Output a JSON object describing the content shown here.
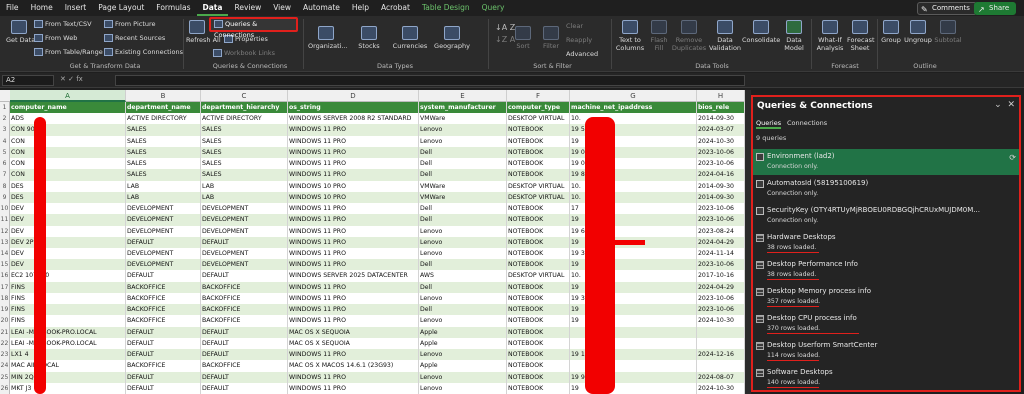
{
  "menu": {
    "tabs": [
      "File",
      "Home",
      "Insert",
      "Page Layout",
      "Formulas",
      "Data",
      "Review",
      "View",
      "Automate",
      "Help",
      "Acrobat",
      "Table Design",
      "Query"
    ],
    "active": "Data",
    "comments_label": "Comments",
    "share_label": "Share"
  },
  "ribbon": {
    "get_data": "Get Data",
    "from_text_csv": "From Text/CSV",
    "from_web": "From Web",
    "from_table_range": "From Table/Range",
    "from_picture": "From Picture",
    "recent_sources": "Recent Sources",
    "existing_connections": "Existing Connections",
    "group_get_transform": "Get & Transform Data",
    "refresh_all": "Refresh All",
    "queries_connections": "Queries & Connections",
    "properties": "Properties",
    "workbook_links": "Workbook Links",
    "group_queries": "Queries & Connections",
    "organization": "Organizati...",
    "stocks": "Stocks",
    "currencies": "Currencies",
    "geography": "Geography",
    "group_data_types": "Data Types",
    "sort": "Sort",
    "filter": "Filter",
    "clear": "Clear",
    "reapply": "Reapply",
    "advanced": "Advanced",
    "group_sort_filter": "Sort & Filter",
    "text_to_columns": "Text to Columns",
    "flash_fill": "Flash Fill",
    "remove_duplicates": "Remove Duplicates",
    "data_validation": "Data Validation",
    "consolidate": "Consolidate",
    "data_model": "Data Model",
    "group_data_tools": "Data Tools",
    "what_if": "What-If Analysis",
    "forecast_sheet": "Forecast Sheet",
    "group_forecast": "Forecast",
    "group_btn": "Group",
    "ungroup_btn": "Ungroup",
    "subtotal": "Subtotal",
    "group_outline": "Outline"
  },
  "formula_bar": {
    "name_box": "A2",
    "fx": "fx",
    "formula": ""
  },
  "sheet": {
    "column_letters": [
      "A",
      "B",
      "C",
      "D",
      "E",
      "F",
      "G",
      "H"
    ],
    "headers": [
      "computer_name",
      "department_name",
      "department_hierarchy",
      "os_string",
      "system_manufacturer",
      "computer_type",
      "machine_net_ipaddress",
      "bios_rele"
    ],
    "rows": [
      [
        "ADS",
        "ACTIVE DIRECTORY",
        "ACTIVE DIRECTORY",
        "WINDOWS SERVER 2008 R2 STANDARD",
        "VMWare",
        "DESKTOP VIRTUAL",
        "10.",
        "2014-09-30"
      ],
      [
        "CON  908",
        "SALES",
        "SALES",
        "WINDOWS 11 PRO",
        "Lenovo",
        "NOTEBOOK",
        "19  55",
        "2024-03-07"
      ],
      [
        "CON",
        "SALES",
        "SALES",
        "WINDOWS 11 PRO",
        "Lenovo",
        "NOTEBOOK",
        "19",
        "2024-10-30"
      ],
      [
        "CON",
        "SALES",
        "SALES",
        "WINDOWS 11 PRO",
        "Dell",
        "NOTEBOOK",
        "19  0",
        "2023-10-06"
      ],
      [
        "CON",
        "SALES",
        "SALES",
        "WINDOWS 11 PRO",
        "Dell",
        "NOTEBOOK",
        "19  0",
        "2023-10-06"
      ],
      [
        "CON",
        "SALES",
        "SALES",
        "WINDOWS 11 PRO",
        "Dell",
        "NOTEBOOK",
        "19  8",
        "2024-04-16"
      ],
      [
        "DES",
        "LAB",
        "LAB",
        "WINDOWS 10 PRO",
        "VMWare",
        "DESKTOP VIRTUAL",
        "10.",
        "2014-09-30"
      ],
      [
        "DES",
        "LAB",
        "LAB",
        "WINDOWS 10 PRO",
        "VMWare",
        "DESKTOP VIRTUAL",
        "10.",
        "2014-09-30"
      ],
      [
        "DEV",
        "DEVELOPMENT",
        "DEVELOPMENT",
        "WINDOWS 11 PRO",
        "Dell",
        "NOTEBOOK",
        "17",
        "2023-10-06"
      ],
      [
        "DEV",
        "DEVELOPMENT",
        "DEVELOPMENT",
        "WINDOWS 11 PRO",
        "Dell",
        "NOTEBOOK",
        "19",
        "2023-10-06"
      ],
      [
        "DEV",
        "DEVELOPMENT",
        "DEVELOPMENT",
        "WINDOWS 11 PRO",
        "Lenovo",
        "NOTEBOOK",
        "19  6",
        "2023-08-24"
      ],
      [
        "DEV  2P1",
        "DEFAULT",
        "DEFAULT",
        "WINDOWS 11 PRO",
        "Lenovo",
        "NOTEBOOK",
        "19",
        "2024-04-29"
      ],
      [
        "DEV",
        "DEVELOPMENT",
        "DEVELOPMENT",
        "WINDOWS 11 PRO",
        "Lenovo",
        "NOTEBOOK",
        "19  3",
        "2024-11-14"
      ],
      [
        "DEV",
        "DEVELOPMENT",
        "DEVELOPMENT",
        "WINDOWS 11 PRO",
        "Dell",
        "NOTEBOOK",
        "19",
        "2023-10-06"
      ],
      [
        "EC2  107DF0",
        "DEFAULT",
        "DEFAULT",
        "WINDOWS SERVER 2025 DATACENTER",
        "AWS",
        "DESKTOP VIRTUAL",
        "10.",
        "2017-10-16"
      ],
      [
        "FINS",
        "BACKOFFICE",
        "BACKOFFICE",
        "WINDOWS 11 PRO",
        "Dell",
        "NOTEBOOK",
        "19",
        "2024-04-29"
      ],
      [
        "FINS",
        "BACKOFFICE",
        "BACKOFFICE",
        "WINDOWS 11 PRO",
        "Lenovo",
        "NOTEBOOK",
        "19  3",
        "2023-10-06"
      ],
      [
        "FINS",
        "BACKOFFICE",
        "BACKOFFICE",
        "WINDOWS 11 PRO",
        "Dell",
        "NOTEBOOK",
        "19",
        "2023-10-06"
      ],
      [
        "FINS",
        "BACKOFFICE",
        "BACKOFFICE",
        "WINDOWS 11 PRO",
        "Lenovo",
        "NOTEBOOK",
        "19",
        "2024-10-30"
      ],
      [
        "LEAI  -MACBOOK-PRO.LOCAL",
        "DEFAULT",
        "DEFAULT",
        "MAC OS X SEQUOIA",
        "Apple",
        "NOTEBOOK",
        "",
        ""
      ],
      [
        "LEAI  -MACBOOK-PRO.LOCAL",
        "DEFAULT",
        "DEFAULT",
        "MAC OS X SEQUOIA",
        "Apple",
        "NOTEBOOK",
        "",
        ""
      ],
      [
        "LX1  4",
        "DEFAULT",
        "DEFAULT",
        "WINDOWS 11 PRO",
        "Lenovo",
        "NOTEBOOK",
        "19  1",
        "2024-12-16"
      ],
      [
        "MAC  AIR.LOCAL",
        "BACKOFFICE",
        "BACKOFFICE",
        "MAC OS X MACOS 14.6.1 (23G93)",
        "Apple",
        "NOTEBOOK",
        "",
        ""
      ],
      [
        "MIN  2QF1E",
        "DEFAULT",
        "DEFAULT",
        "WINDOWS 11 PRO",
        "Lenovo",
        "NOTEBOOK",
        "19  9",
        "2024-08-07"
      ],
      [
        "MKT  J3",
        "DEFAULT",
        "DEFAULT",
        "WINDOWS 11 PRO",
        "Lenovo",
        "NOTEBOOK",
        "19",
        "2024-10-30"
      ]
    ]
  },
  "pane": {
    "title": "Queries & Connections",
    "tab_queries": "Queries",
    "tab_connections": "Connections",
    "count": "9 queries",
    "items": [
      {
        "name": "Environment (lad2)",
        "status": "Connection only.",
        "icon": "connection-icon"
      },
      {
        "name": "AutomatosId (58195100619)",
        "status": "Connection only.",
        "icon": "connection-icon"
      },
      {
        "name": "SecurityKey (OTY4RTUyMjRBOEU0RDBGQjhCRUxMUJDM0M...",
        "status": "Connection only.",
        "icon": "connection-icon"
      },
      {
        "name": "Hardware Desktops",
        "status": "38 rows loaded.",
        "icon": "table-icon"
      },
      {
        "name": "Desktop Performance Info",
        "status": "38 rows loaded.",
        "icon": "table-icon"
      },
      {
        "name": "Desktop Memory process info",
        "status": "357 rows loaded.",
        "icon": "table-icon"
      },
      {
        "name": "Desktop CPU process info",
        "status": "370 rows loaded.",
        "icon": "table-icon"
      },
      {
        "name": "Desktop Userform SmartCenter",
        "status": "114 rows loaded.",
        "icon": "table-icon"
      },
      {
        "name": "Software Desktops",
        "status": "140 rows loaded.",
        "icon": "table-icon"
      }
    ]
  },
  "colors": {
    "accent": "#217346",
    "highlight": "#e0201c",
    "header_green": "#3a8a3a",
    "band": "#e2efda"
  }
}
